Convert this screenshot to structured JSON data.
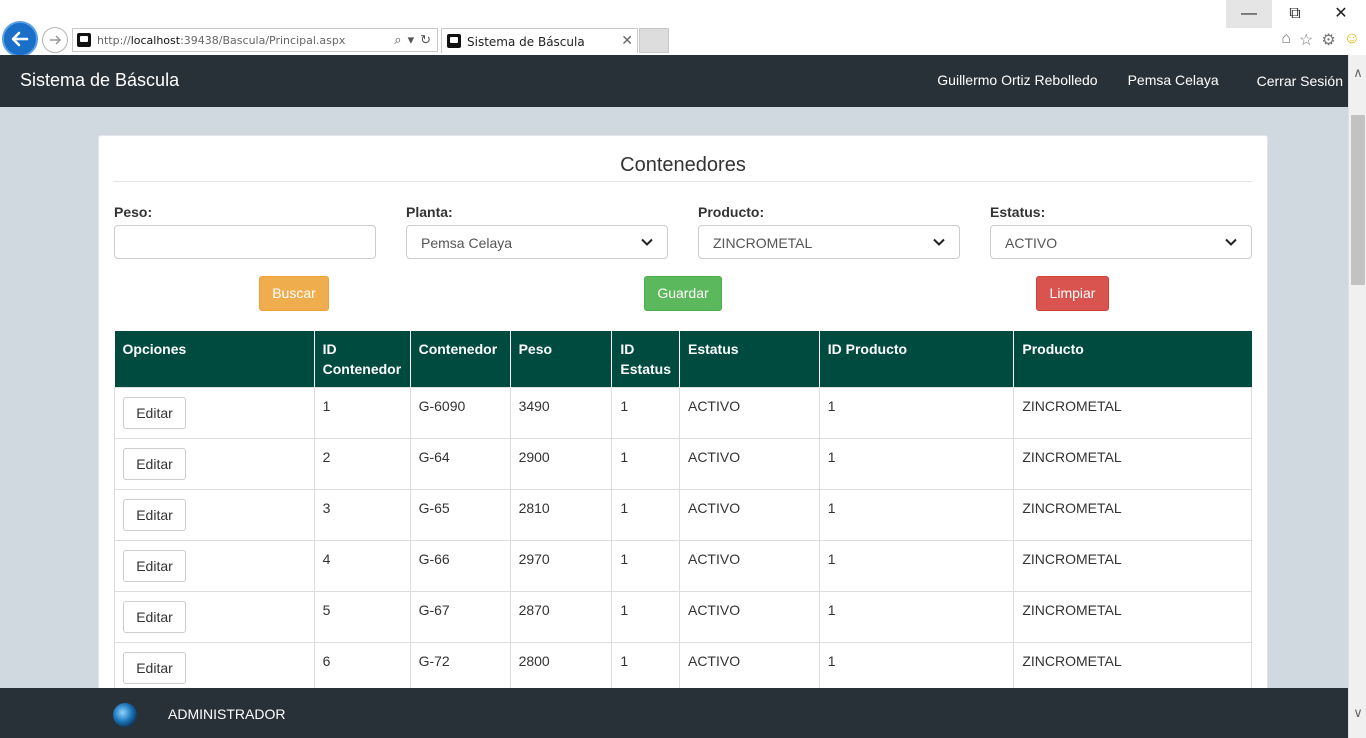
{
  "browser": {
    "url_prefix": "http://",
    "url_host": "localhost",
    "url_rest": ":39438/Bascula/Principal.aspx",
    "tab_title": "Sistema de Báscula"
  },
  "header": {
    "brand": "Sistema de Báscula",
    "user_name": "Guillermo Ortiz Rebolledo",
    "plant": "Pemsa Celaya",
    "logout": "Cerrar Sesión"
  },
  "form": {
    "title": "Contenedores",
    "peso_label": "Peso:",
    "peso_value": "",
    "planta_label": "Planta:",
    "planta_value": "Pemsa Celaya",
    "producto_label": "Producto:",
    "producto_value": "ZINCROMETAL",
    "estatus_label": "Estatus:",
    "estatus_value": "ACTIVO",
    "buscar": "Buscar",
    "guardar": "Guardar",
    "limpiar": "Limpiar"
  },
  "table": {
    "headers": [
      "Opciones",
      "ID Contenedor",
      "Contenedor",
      "Peso",
      "ID Estatus",
      "Estatus",
      "ID Producto",
      "Producto"
    ],
    "edit_label": "Editar",
    "rows": [
      {
        "id": "1",
        "contenedor": "G-6090",
        "peso": "3490",
        "id_estatus": "1",
        "estatus": "ACTIVO",
        "id_producto": "1",
        "producto": "ZINCROMETAL"
      },
      {
        "id": "2",
        "contenedor": "G-64",
        "peso": "2900",
        "id_estatus": "1",
        "estatus": "ACTIVO",
        "id_producto": "1",
        "producto": "ZINCROMETAL"
      },
      {
        "id": "3",
        "contenedor": "G-65",
        "peso": "2810",
        "id_estatus": "1",
        "estatus": "ACTIVO",
        "id_producto": "1",
        "producto": "ZINCROMETAL"
      },
      {
        "id": "4",
        "contenedor": "G-66",
        "peso": "2970",
        "id_estatus": "1",
        "estatus": "ACTIVO",
        "id_producto": "1",
        "producto": "ZINCROMETAL"
      },
      {
        "id": "5",
        "contenedor": "G-67",
        "peso": "2870",
        "id_estatus": "1",
        "estatus": "ACTIVO",
        "id_producto": "1",
        "producto": "ZINCROMETAL"
      },
      {
        "id": "6",
        "contenedor": "G-72",
        "peso": "2800",
        "id_estatus": "1",
        "estatus": "ACTIVO",
        "id_producto": "1",
        "producto": "ZINCROMETAL"
      }
    ]
  },
  "footer": {
    "role": "ADMINISTRADOR"
  },
  "colors": {
    "navbar": "#293138",
    "table_header": "#004b40",
    "buscar": "#f0ad4e",
    "guardar": "#5cb85c",
    "limpiar": "#d9534f"
  }
}
